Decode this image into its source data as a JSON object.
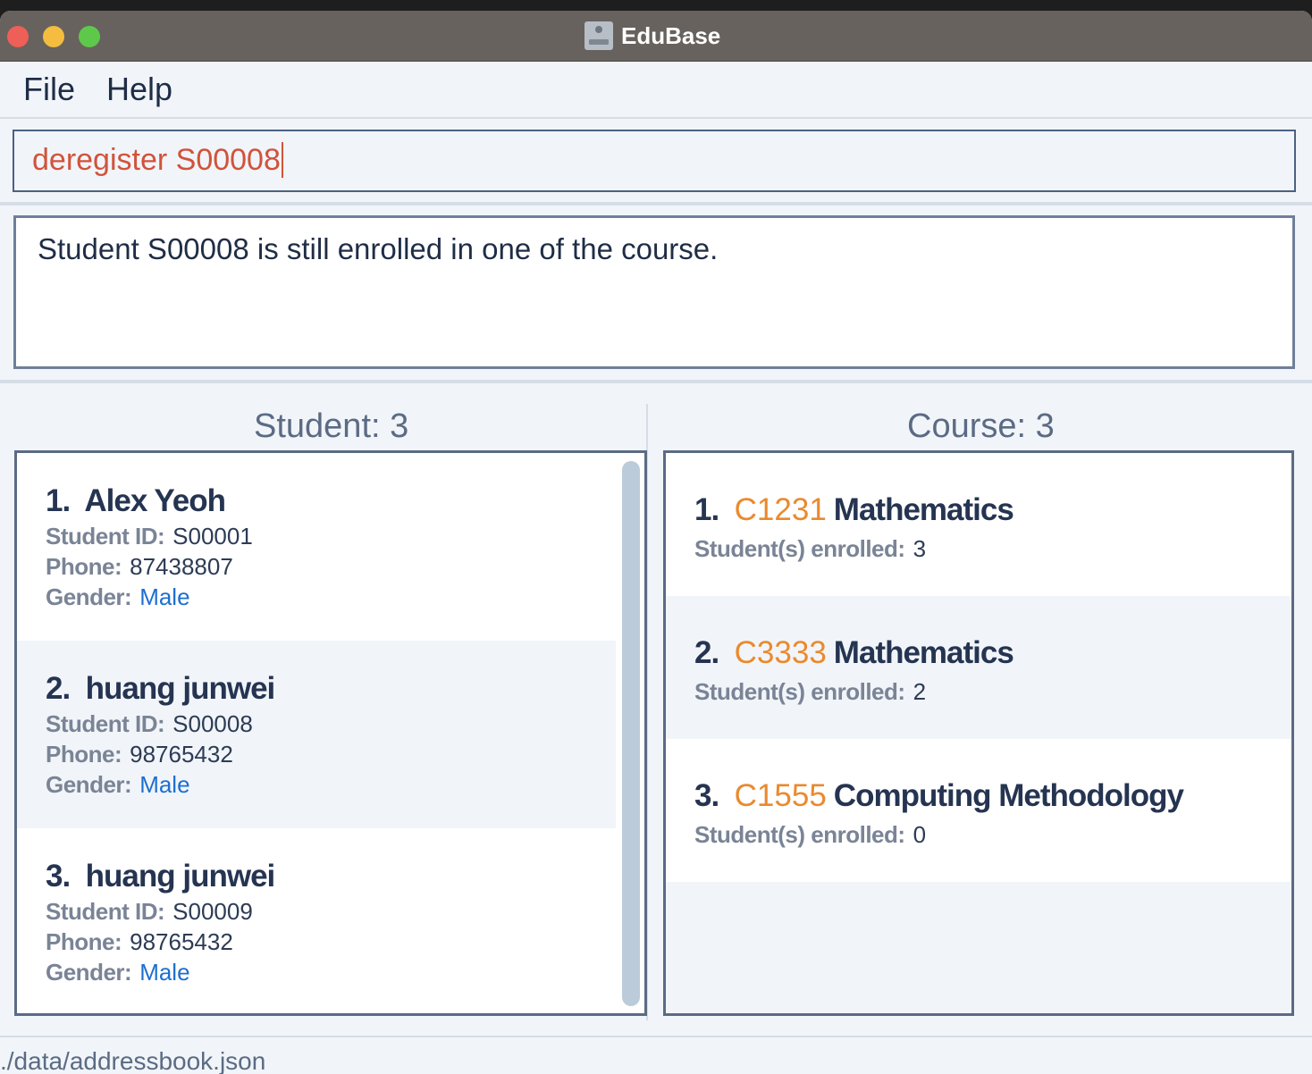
{
  "window": {
    "title": "EduBase",
    "icon": "edubase-app-icon"
  },
  "menu": {
    "file": "File",
    "help": "Help"
  },
  "command": {
    "value": "deregister S00008"
  },
  "result": {
    "message": "Student S00008 is still enrolled in one of the course."
  },
  "students": {
    "title": "Student: 3",
    "labels": {
      "id": "Student ID:",
      "phone": "Phone:",
      "gender": "Gender:"
    },
    "items": [
      {
        "index": "1.",
        "name": "Alex Yeoh",
        "id": "S00001",
        "phone": "87438807",
        "gender": "Male"
      },
      {
        "index": "2.",
        "name": "huang junwei",
        "id": "S00008",
        "phone": "98765432",
        "gender": "Male"
      },
      {
        "index": "3.",
        "name": "huang junwei",
        "id": "S00009",
        "phone": "98765432",
        "gender": "Male"
      }
    ]
  },
  "courses": {
    "title": "Course: 3",
    "enrolled_label": "Student(s) enrolled:",
    "items": [
      {
        "index": "1.",
        "code": "C1231",
        "name": "Mathematics",
        "enrolled": "3"
      },
      {
        "index": "2.",
        "code": "C3333",
        "name": "Mathematics",
        "enrolled": "2"
      },
      {
        "index": "3.",
        "code": "C1555",
        "name": "Computing Methodology",
        "enrolled": "0"
      }
    ]
  },
  "status": {
    "path": "./data/addressbook.json"
  },
  "colors": {
    "accent_code": "#ea8a2e",
    "gender": "#1d6fd1",
    "command_text": "#d1533b"
  }
}
